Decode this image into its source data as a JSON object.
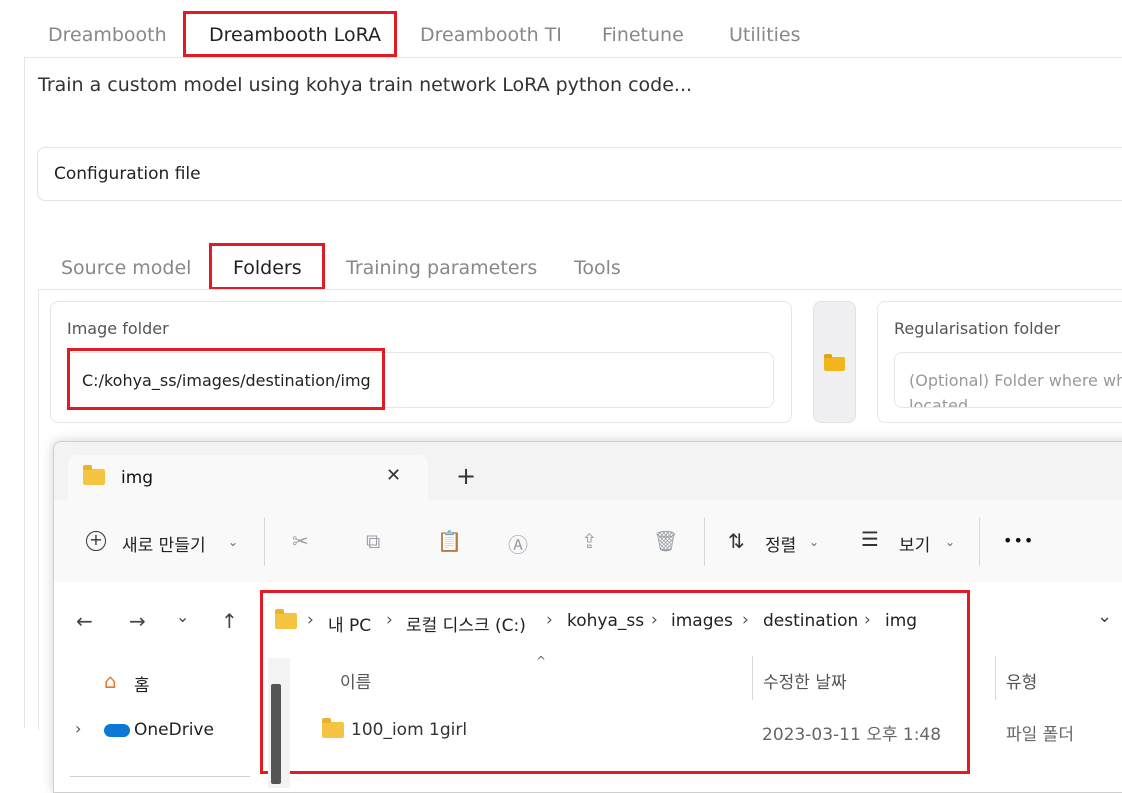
{
  "top_tabs": [
    "Dreambooth",
    "Dreambooth LoRA",
    "Dreambooth TI",
    "Finetune",
    "Utilities"
  ],
  "description": "Train a custom model using kohya train network LoRA python code...",
  "config_label": "Configuration file",
  "sub_tabs": [
    "Source model",
    "Folders",
    "Training parameters",
    "Tools"
  ],
  "image_folder": {
    "label": "Image folder",
    "value": "C:/kohya_ss/images/destination/img"
  },
  "reg_folder": {
    "label": "Regularisation folder",
    "placeholder_line1": "(Optional) Folder where wh",
    "placeholder_line2": "located"
  },
  "folder_button_icon": "folder-open-icon",
  "explorer": {
    "tab_title": "img",
    "close_glyph": "✕",
    "new_tab_glyph": "+",
    "new_label": "새로 만들기",
    "sort_label": "정렬",
    "view_label": "보기",
    "more_glyph": "•••",
    "breadcrumb": [
      "내 PC",
      "로컬 디스크 (C:)",
      "kohya_ss",
      "images",
      "destination",
      "img"
    ],
    "columns": {
      "name": "이름",
      "date": "수정한 날짜",
      "type": "유형"
    },
    "rows": [
      {
        "name": "100_iom 1girl",
        "date": "2023-03-11 오후 1:48",
        "type": "파일 폴더"
      }
    ],
    "sidebar": {
      "home": "홈",
      "onedrive": "OneDrive"
    }
  },
  "colors": {
    "highlight": "#e01b24",
    "folder": "#f5c542"
  }
}
